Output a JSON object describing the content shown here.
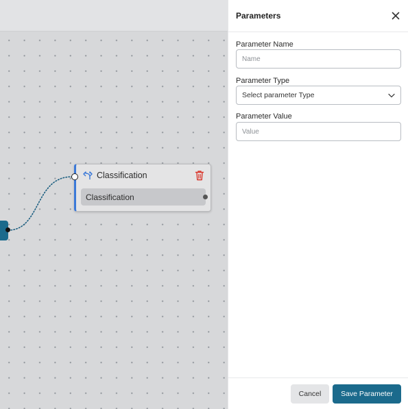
{
  "canvas": {
    "node": {
      "title": "Classification",
      "output_label": "Classification",
      "icon": "split-arrows-icon",
      "accent_color": "#3b79d8",
      "trash_icon_color": "#d9362b"
    },
    "source_node_color": "#1b6a8c"
  },
  "panel": {
    "title": "Parameters",
    "close_icon": "close-icon",
    "fields": {
      "name": {
        "label": "Parameter Name",
        "placeholder": "Name",
        "value": ""
      },
      "type": {
        "label": "Parameter Type",
        "selected": "Select parameter Type"
      },
      "value": {
        "label": "Parameter Value",
        "placeholder": "Value",
        "value": ""
      }
    },
    "footer": {
      "cancel_label": "Cancel",
      "save_label": "Save Parameter",
      "save_color": "#1b6a8c"
    }
  }
}
